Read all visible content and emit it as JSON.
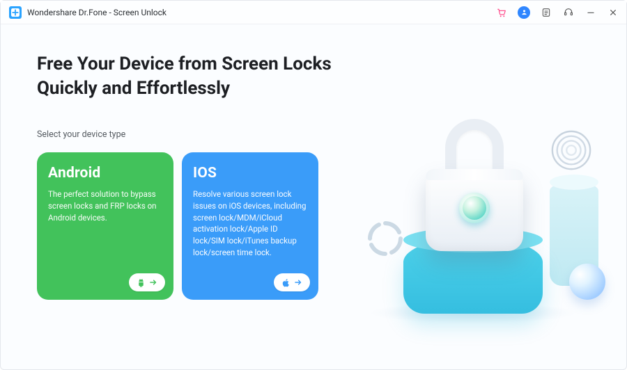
{
  "titlebar": {
    "app_title": "Wondershare Dr.Fone - Screen Unlock",
    "icons": {
      "cart": "cart-icon",
      "account": "account-icon",
      "notes": "notes-icon",
      "support": "support-icon",
      "minimize": "minimize-icon",
      "close": "close-icon"
    }
  },
  "main": {
    "heading": "Free Your Device from Screen Locks Quickly and Effortlessly",
    "subheading": "Select your device type"
  },
  "cards": {
    "android": {
      "title": "Android",
      "desc": "The perfect solution to bypass screen locks and FRP locks on Android devices.",
      "icon": "android-icon"
    },
    "ios": {
      "title": "IOS",
      "desc": "Resolve various screen lock issues on iOS devices, including screen lock/MDM/iCloud activation lock/Apple ID lock/SIM lock/iTunes backup lock/screen time lock.",
      "icon": "apple-icon"
    }
  },
  "colors": {
    "android": "#42c25b",
    "ios": "#3a9cf9",
    "accent": "#2f86ff"
  }
}
